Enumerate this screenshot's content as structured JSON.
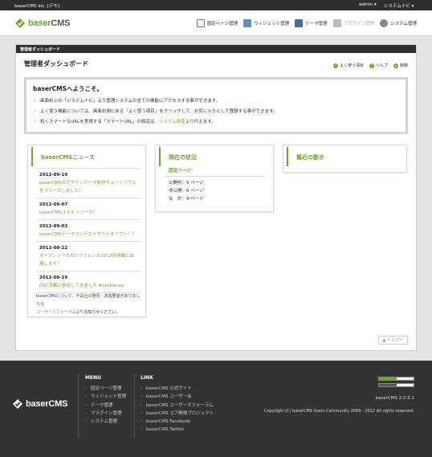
{
  "topbar": {
    "site_name": "baserCMS inc. [デモ]",
    "user_menu": "admin ▾",
    "system_nav": "システムナビ ▾"
  },
  "header": {
    "logo_prefix": "baser",
    "logo_suffix": "CMS",
    "nav": [
      {
        "label": "固定ページ管理",
        "icon": "page-icon"
      },
      {
        "label": "ウィジェット管理",
        "icon": "widget-icon"
      },
      {
        "label": "テーマ管理",
        "icon": "theme-icon"
      },
      {
        "label": "プラグイン管理",
        "icon": "plugin-icon"
      },
      {
        "label": "システム管理",
        "icon": "gear-icon"
      }
    ]
  },
  "panel": {
    "bar_label": "管理者ダッシュボード",
    "title": "管理者ダッシュボード",
    "links": {
      "favorites": "よく使う項目",
      "help": "ヘルプ",
      "collapse": "制御"
    },
    "to_top": "▲ トップへ"
  },
  "welcome": {
    "title": "baserCMSへようこそ。",
    "line1": "画面右上の「システムナビ」より管理システムの全ての機能にアクセスする事ができます。",
    "line2": "よく使う機能については、画面右側にある「よく使う項目」をクリックして、お気に入りとして登録する事ができます。",
    "line3_pre": "短くスマートなURLを実現する「スマートURL」の設定は、",
    "line3_link": "システム設定",
    "line3_post": "より行えます。"
  },
  "news": {
    "title": "baserCMSニュース",
    "items": [
      {
        "date": "2012-09-19",
        "title": "baserCMSのデザインテーマ制作チュートリアルをリリースしました！"
      },
      {
        "date": "2012-09-07",
        "title": "baserCMS 2.0.5 リリース！"
      },
      {
        "date": "2012-09-03",
        "title": "baserCMSテーマコンテストサイトオープン！！"
      },
      {
        "date": "2012-08-22",
        "title": "オープンソースカンファレンス2012＠沖縄に出展します！"
      },
      {
        "date": "2012-08-19",
        "title": "OSC京都に参加してきました #osckansai"
      }
    ],
    "note_line1": "baserCMSについて、不具合の発見・改善要望がありましたら",
    "note_link": "ユーザーズフォーラム",
    "note_line2": "よりお知らせください。"
  },
  "status": {
    "title": "現在の状況",
    "subtitle": "固定ページ",
    "rows": [
      {
        "label": "公開中：",
        "value": "9 ページ"
      },
      {
        "label": "非公開：",
        "value": "0 ページ"
      },
      {
        "label": "合　計：",
        "value": "9 ページ"
      }
    ]
  },
  "recent": {
    "title": "最近の動き"
  },
  "footer": {
    "menu_title": "MENU",
    "menu_items": [
      "固定ページ管理",
      "ウィジェット管理",
      "テーマ管理",
      "プラグイン管理",
      "システム管理"
    ],
    "link_title": "LINK",
    "link_items": [
      "baserCMS 公式サイト",
      "baserCMS ユーザー会",
      "baserCMS ユーザーズフォーラム",
      "baserCMS コア開発プロジェクト",
      "baserCMS Facebook",
      "baserCMS Twitter"
    ],
    "version": "baserCMS 2.0.5.1",
    "copyright": "Copyright (C) baserCMS Users Community 2009 - 2012 All rights reserved."
  },
  "colors": {
    "accent": "#6aa82e",
    "dark": "#2e2e2e",
    "footer_bg": "#333333"
  }
}
